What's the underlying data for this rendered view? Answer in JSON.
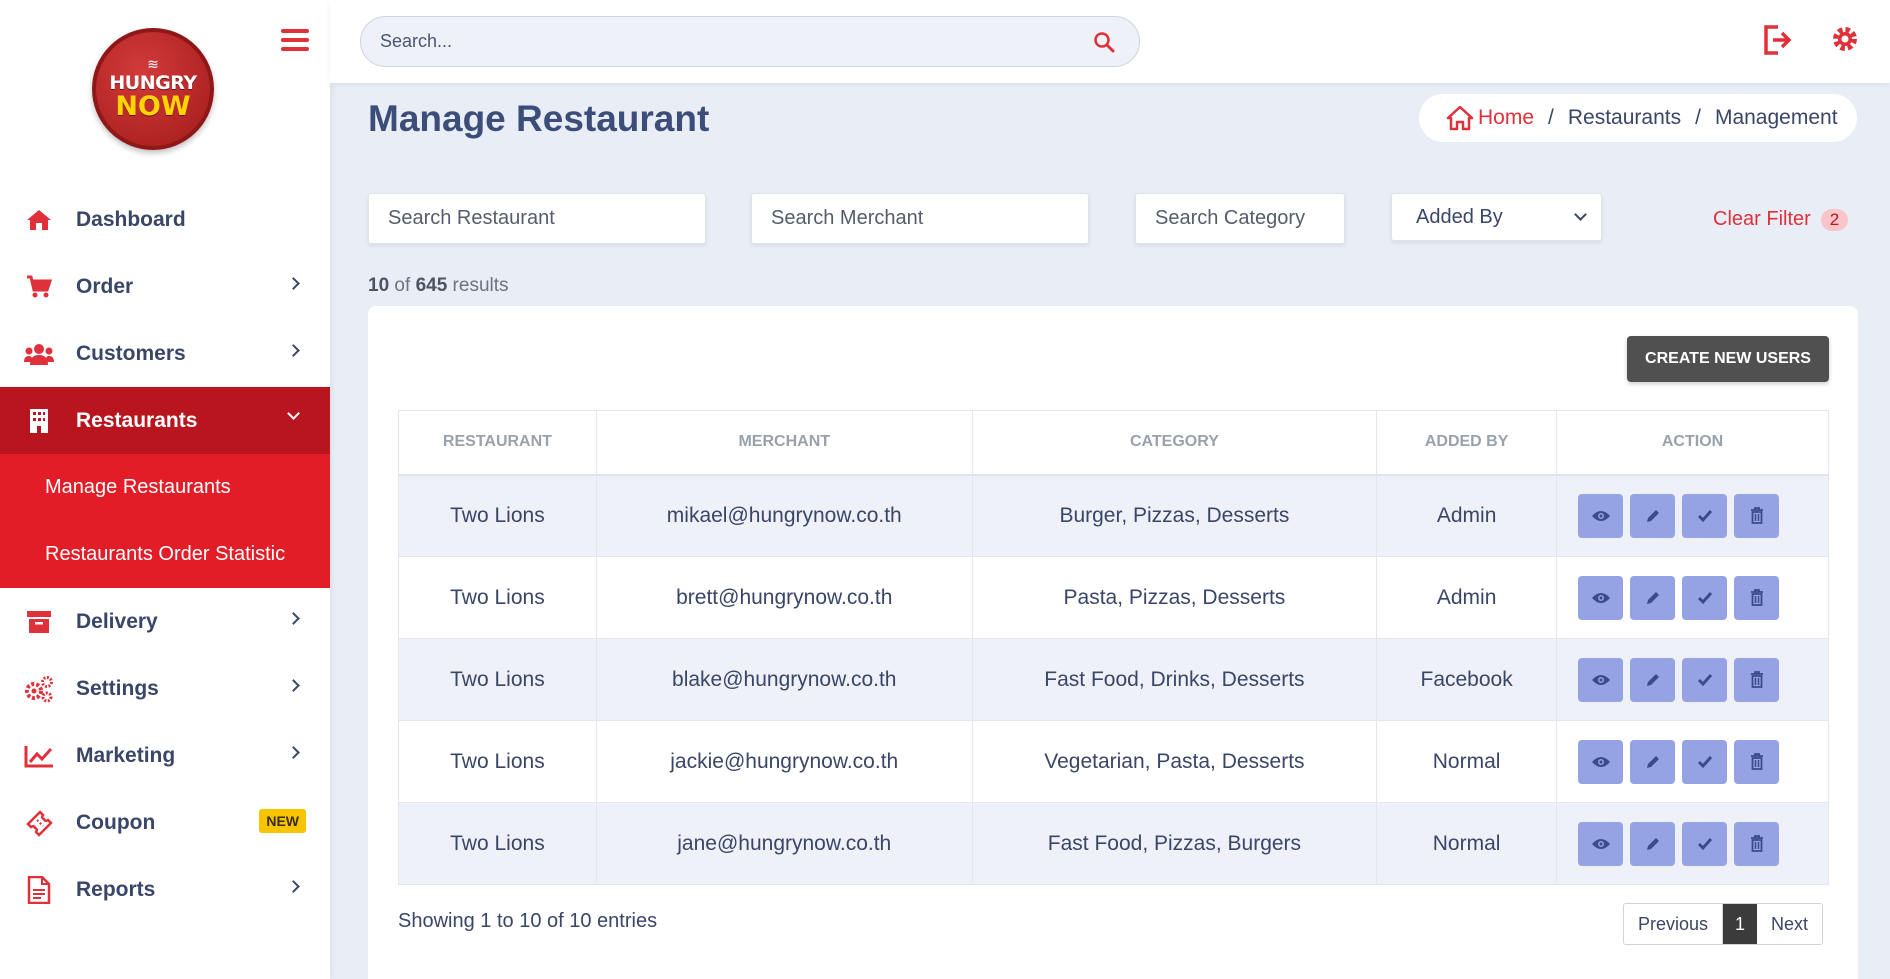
{
  "brand": {
    "logo_line1": "HUNGRY",
    "logo_line2": "NOW"
  },
  "topbar": {
    "search_placeholder": "Search..."
  },
  "sidebar": {
    "items": [
      {
        "label": "Dashboard",
        "icon": "home-icon"
      },
      {
        "label": "Order",
        "icon": "cart-icon"
      },
      {
        "label": "Customers",
        "icon": "users-icon"
      },
      {
        "label": "Restaurants",
        "icon": "building-icon"
      },
      {
        "label": "Delivery",
        "icon": "archive-icon"
      },
      {
        "label": "Settings",
        "icon": "gears-icon"
      },
      {
        "label": "Marketing",
        "icon": "chart-line-icon"
      },
      {
        "label": "Coupon",
        "icon": "ticket-icon",
        "badge": "NEW"
      },
      {
        "label": "Reports",
        "icon": "document-icon"
      }
    ],
    "submenu": [
      "Manage Restaurants",
      "Restaurants Order Statistic"
    ]
  },
  "page": {
    "title": "Manage Restaurant",
    "breadcrumb": {
      "home": "Home",
      "level1": "Restaurants",
      "level2": "Management",
      "separator": "/"
    }
  },
  "filters": {
    "restaurant_placeholder": "Search Restaurant",
    "merchant_placeholder": "Search Merchant",
    "category_placeholder": "Search Category",
    "added_by": "Added By",
    "clear_label": "Clear Filter",
    "clear_count": "2"
  },
  "results": {
    "shown": "10",
    "of_label": "of",
    "total": "645",
    "suffix": "results"
  },
  "create_button": "CREATE NEW USERS",
  "table": {
    "headers": [
      "Restaurant",
      "Merchant",
      "Category",
      "Added By",
      "Action"
    ],
    "rows": [
      {
        "restaurant": "Two Lions",
        "merchant": "mikael@hungrynow.co.th",
        "category": "Burger, Pizzas, Desserts",
        "added_by": "Admin"
      },
      {
        "restaurant": "Two Lions",
        "merchant": "brett@hungrynow.co.th",
        "category": "Pasta, Pizzas, Desserts",
        "added_by": "Admin"
      },
      {
        "restaurant": "Two Lions",
        "merchant": "blake@hungrynow.co.th",
        "category": "Fast Food, Drinks, Desserts",
        "added_by": "Facebook"
      },
      {
        "restaurant": "Two Lions",
        "merchant": "jackie@hungrynow.co.th",
        "category": "Vegetarian, Pasta, Desserts",
        "added_by": "Normal"
      },
      {
        "restaurant": "Two Lions",
        "merchant": "jane@hungrynow.co.th",
        "category": "Fast Food, Pizzas, Burgers",
        "added_by": "Normal"
      }
    ]
  },
  "footer": {
    "showing": "Showing 1 to 10 of 10 entries",
    "pagination": {
      "previous": "Previous",
      "current": "1",
      "next": "Next"
    }
  },
  "colors": {
    "accent": "#e0303a",
    "active_bg": "#b9151e",
    "submenu_bg": "#e21d27",
    "action_btn": "#95a3e4"
  }
}
